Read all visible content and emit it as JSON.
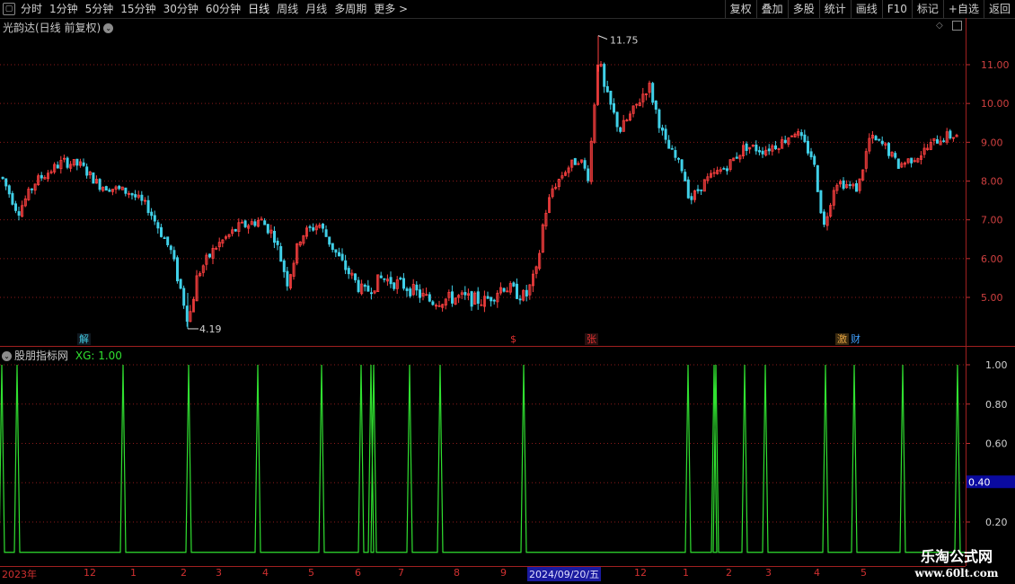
{
  "toolbar": {
    "periods": [
      "分时",
      "1分钟",
      "5分钟",
      "15分钟",
      "30分钟",
      "60分钟",
      "日线",
      "周线",
      "月线",
      "多周期",
      "更多"
    ],
    "active": "日线",
    "right_buttons": [
      "复权",
      "叠加",
      "多股",
      "统计",
      "画线",
      "F10",
      "标记",
      "+自选",
      "返回"
    ]
  },
  "main_panel": {
    "title": "光韵达(日线 前复权)",
    "high_label": "11.75",
    "low_label": "4.19",
    "y_ticks": [
      "11.00",
      "10.00",
      "9.00",
      "8.00",
      "7.00",
      "6.00",
      "5.00"
    ],
    "markers": [
      {
        "text": "解",
        "color": "#40c8e0"
      },
      {
        "text": "$",
        "color": "#e03030"
      },
      {
        "text": "张",
        "color": "#e03030"
      },
      {
        "text": "激",
        "color": "#e0a040"
      },
      {
        "text": "财",
        "color": "#40a0ff"
      }
    ]
  },
  "indicator_panel": {
    "title": "股朋指标网",
    "series_label": "XG: 1.00",
    "y_ticks": [
      "1.00",
      "0.80",
      "0.60",
      "0.40",
      "0.20"
    ],
    "cursor_value": "0.40"
  },
  "date_axis": {
    "labels": [
      "2023年",
      "12",
      "1",
      "2",
      "3",
      "4",
      "5",
      "6",
      "7",
      "8",
      "9",
      "2024/09/20/五",
      "12",
      "1",
      "2",
      "3",
      "4",
      "5"
    ],
    "highlight": "2024/09/20/五"
  },
  "watermark": {
    "line1": "乐淘公式网",
    "line2": "www.60lt.com"
  },
  "colors": {
    "up": "#ff4040",
    "down": "#40d0e8",
    "indicator": "#30e030",
    "grid": "#8b1a1a",
    "axis": "#c03030"
  },
  "chart_data": {
    "type": "candlestick",
    "y_range": [
      4.19,
      11.75
    ],
    "high": 11.75,
    "low": 4.19,
    "indicator": {
      "name": "XG",
      "range": [
        0,
        1
      ],
      "value": 1.0
    }
  }
}
